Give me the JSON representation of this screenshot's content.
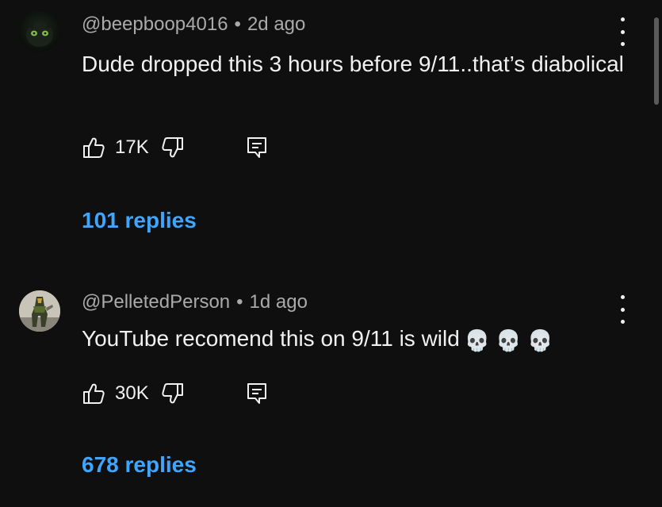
{
  "comments": [
    {
      "username": "@beepboop4016",
      "time": "2d ago",
      "text": "Dude dropped this 3 hours before 9/11..that’s diabolical",
      "likes": "17K",
      "replies": "101 replies"
    },
    {
      "username": "@PelletedPerson",
      "time": "1d ago",
      "text": "YouTube recomend this on 9/11 is wild",
      "emoji": "💀 💀 💀",
      "likes": "30K",
      "replies": "678 replies"
    }
  ],
  "separator": "•",
  "icons": {
    "like": "thumbs-up-icon",
    "dislike": "thumbs-down-icon",
    "reply": "reply-icon",
    "more": "more-vert-icon"
  },
  "colors": {
    "background": "#0f0f0f",
    "text": "#f1f1f1",
    "meta": "#aaaaaa",
    "link": "#3ea6ff"
  }
}
